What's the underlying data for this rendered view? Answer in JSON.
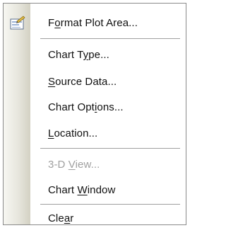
{
  "menu": {
    "items": [
      {
        "pre": "F",
        "acc": "o",
        "post": "rmat Plot Area...",
        "disabled": false,
        "icon": "format-plot-area-icon"
      },
      {
        "pre": "Chart T",
        "acc": "y",
        "post": "pe...",
        "disabled": false
      },
      {
        "pre": "",
        "acc": "S",
        "post": "ource Data...",
        "disabled": false
      },
      {
        "pre": "Chart Opt",
        "acc": "i",
        "post": "ons...",
        "disabled": false
      },
      {
        "pre": "",
        "acc": "L",
        "post": "ocation...",
        "disabled": false
      },
      {
        "pre": "3-D ",
        "acc": "V",
        "post": "iew...",
        "disabled": true
      },
      {
        "pre": "Chart ",
        "acc": "W",
        "post": "indow",
        "disabled": false
      },
      {
        "pre": "Cle",
        "acc": "a",
        "post": "r",
        "disabled": false
      }
    ]
  },
  "colors": {
    "text": "#101010",
    "disabled_text": "#a0a0a0",
    "gutter": "#e7e6dd",
    "separator": "#9f9f9f",
    "border": "#8a8a8a"
  }
}
